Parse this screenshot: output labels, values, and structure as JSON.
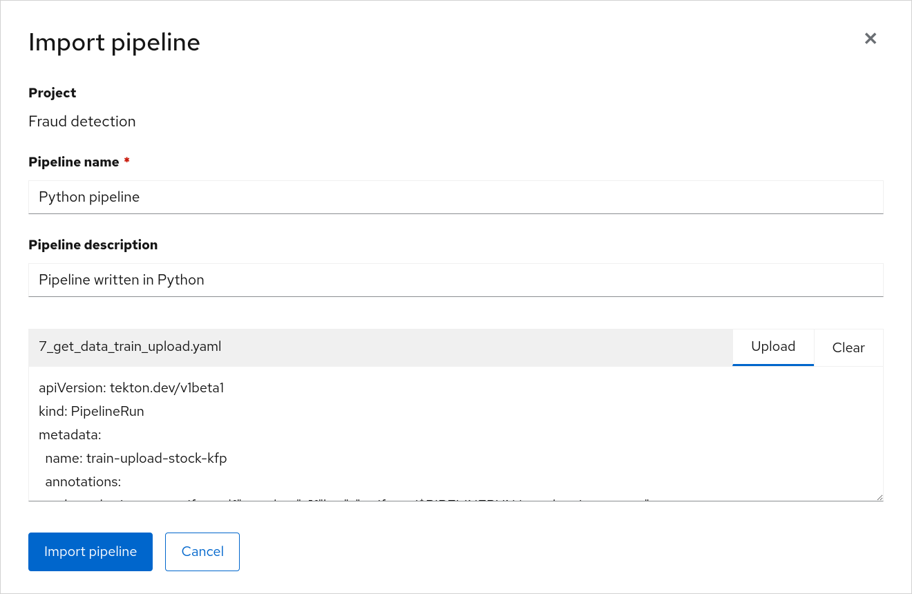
{
  "modal": {
    "title": "Import pipeline"
  },
  "form": {
    "project_label": "Project",
    "project_value": "Fraud detection",
    "name_label": "Pipeline name",
    "name_value": "Python pipeline",
    "description_label": "Pipeline description",
    "description_value": "Pipeline written in Python",
    "file_name": "7_get_data_train_upload.yaml",
    "upload_label": "Upload",
    "clear_label": "Clear",
    "yaml_content": "apiVersion: tekton.dev/v1beta1\nkind: PipelineRun\nmetadata:\n  name: train-upload-stock-kfp\n  annotations:\n    tekton.dev/output_artifacts: '{\"get-data\": [{\"key\": \"artifacts/$PIPELINERUN/get-data/output.tgz\","
  },
  "buttons": {
    "import": "Import pipeline",
    "cancel": "Cancel"
  }
}
